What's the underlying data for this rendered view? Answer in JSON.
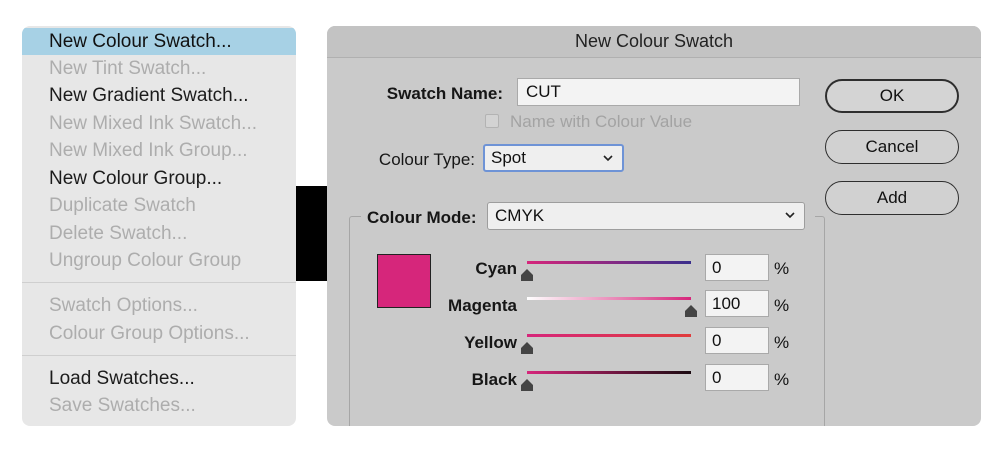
{
  "menu": {
    "items": [
      {
        "label": "New Colour Swatch...",
        "state": "highlighted"
      },
      {
        "label": "New Tint Swatch...",
        "state": "disabled"
      },
      {
        "label": "New Gradient Swatch...",
        "state": "enabled"
      },
      {
        "label": "New Mixed Ink Swatch...",
        "state": "disabled"
      },
      {
        "label": "New Mixed Ink Group...",
        "state": "disabled"
      },
      {
        "label": "New Colour Group...",
        "state": "enabled"
      },
      {
        "label": "Duplicate Swatch",
        "state": "disabled"
      },
      {
        "label": "Delete Swatch...",
        "state": "disabled"
      },
      {
        "label": "Ungroup Colour Group",
        "state": "disabled"
      },
      {
        "label": "Swatch Options...",
        "state": "disabled"
      },
      {
        "label": "Colour Group Options...",
        "state": "disabled"
      },
      {
        "label": "Load Swatches...",
        "state": "enabled"
      },
      {
        "label": "Save Swatches...",
        "state": "disabled"
      }
    ]
  },
  "dialog": {
    "title": "New Colour Swatch",
    "swatch_name_label": "Swatch Name:",
    "swatch_name_value": "CUT",
    "name_with_value_label": "Name with Colour Value",
    "name_with_value_checked": false,
    "colour_type_label": "Colour Type:",
    "colour_type_value": "Spot",
    "colour_mode_label": "Colour Mode:",
    "colour_mode_value": "CMYK",
    "buttons": {
      "ok": "OK",
      "cancel": "Cancel",
      "add": "Add"
    },
    "swatch_color": "#d6267b",
    "channels": [
      {
        "name": "Cyan",
        "value": "0",
        "unit": "%",
        "fraction": 0.0
      },
      {
        "name": "Magenta",
        "value": "100",
        "unit": "%",
        "fraction": 1.0
      },
      {
        "name": "Yellow",
        "value": "0",
        "unit": "%",
        "fraction": 0.0
      },
      {
        "name": "Black",
        "value": "0",
        "unit": "%",
        "fraction": 0.0
      }
    ]
  },
  "colors": {
    "highlight": "#a7d1e5",
    "focus_ring": "#6e93d6"
  },
  "icons": {
    "dropdown": "chevron-down-icon",
    "slider_handle": "slider-handle-icon"
  }
}
